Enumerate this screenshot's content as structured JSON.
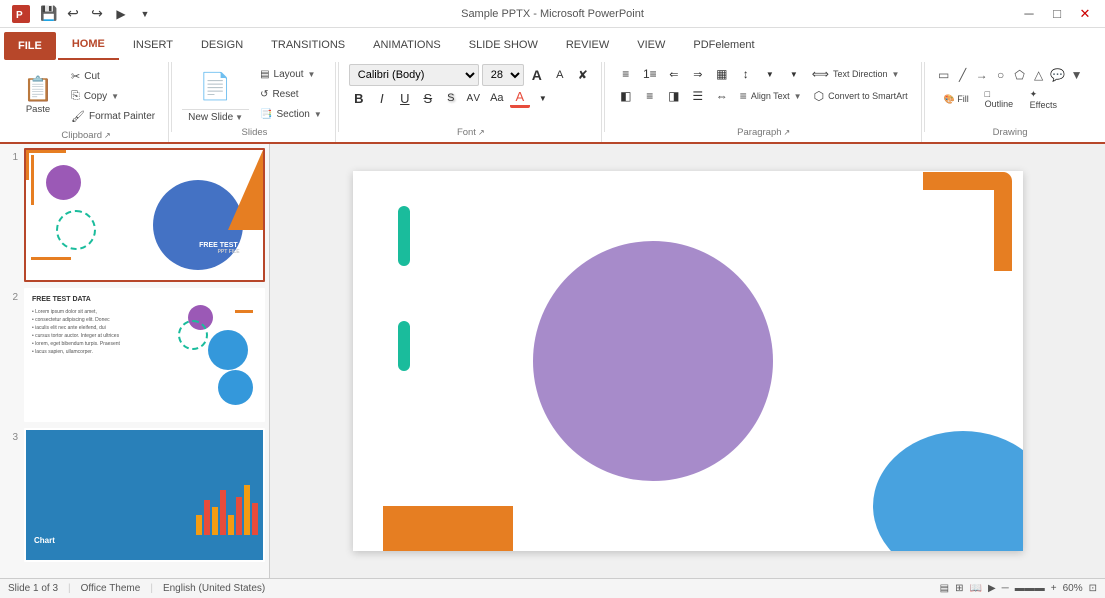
{
  "titleBar": {
    "title": "Sample PPTX - Microsoft PowerPoint",
    "icons": [
      "minimize",
      "maximize",
      "close"
    ]
  },
  "quickAccess": {
    "icons": [
      "save",
      "undo",
      "redo",
      "present",
      "dropdown"
    ]
  },
  "tabs": [
    {
      "id": "file",
      "label": "FILE",
      "active": false,
      "isFile": true
    },
    {
      "id": "home",
      "label": "HOME",
      "active": true
    },
    {
      "id": "insert",
      "label": "INSERT",
      "active": false
    },
    {
      "id": "design",
      "label": "DESIGN",
      "active": false
    },
    {
      "id": "transitions",
      "label": "TRANSITIONS",
      "active": false
    },
    {
      "id": "animations",
      "label": "ANIMATIONS",
      "active": false
    },
    {
      "id": "slideshow",
      "label": "SLIDE SHOW",
      "active": false
    },
    {
      "id": "review",
      "label": "REVIEW",
      "active": false
    },
    {
      "id": "view",
      "label": "VIEW",
      "active": false
    },
    {
      "id": "pdfelement",
      "label": "PDFelement",
      "active": false
    }
  ],
  "ribbon": {
    "groups": {
      "clipboard": {
        "label": "Clipboard",
        "paste": "Paste",
        "cut": "Cut",
        "copy": "Copy",
        "formatPainter": "Format Painter"
      },
      "slides": {
        "label": "Slides",
        "newSlide": "New Slide",
        "layout": "Layout",
        "reset": "Reset",
        "section": "Section"
      },
      "font": {
        "label": "Font",
        "fontName": "Calibri (Body)",
        "fontSize": "28",
        "bold": "B",
        "italic": "I",
        "underline": "U",
        "strikethrough": "abc",
        "shadowBtn": "S",
        "charSpacing": "AV",
        "fontColor": "A",
        "fontColorLabel": "Font Color"
      },
      "paragraph": {
        "label": "Paragraph",
        "textDir": "Text Direction",
        "alignText": "Align Text",
        "convertSmartArt": "Convert to SmartArt"
      },
      "drawing": {
        "label": "Drawing"
      }
    }
  },
  "slides": [
    {
      "number": "1",
      "selected": true,
      "title": "FREE TEST DATA",
      "subtitle": "PPT FILE"
    },
    {
      "number": "2",
      "selected": false,
      "title": "FREE TEST DATA",
      "body": "Lorem ipsum dolor sit amet, consectetur adipiscing elit..."
    },
    {
      "number": "3",
      "selected": false,
      "title": "Chart"
    }
  ],
  "statusBar": {
    "slideInfo": "Slide 1 of 3",
    "theme": "Office Theme",
    "language": "English (United States)"
  }
}
